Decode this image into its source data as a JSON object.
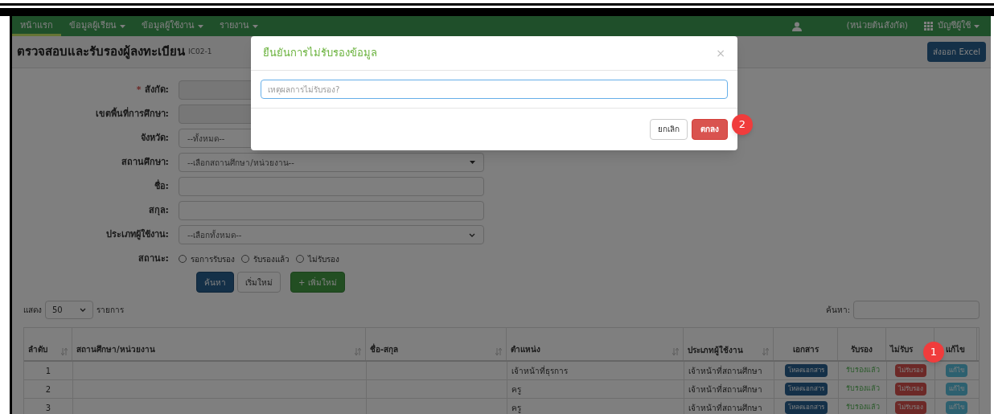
{
  "navbar": {
    "items": [
      {
        "label": "หน้าแรก",
        "selected": true,
        "dropdown": false
      },
      {
        "label": "ข้อมูลผู้เรียน",
        "selected": false,
        "dropdown": true
      },
      {
        "label": "ข้อมูลผู้ใช้งาน",
        "selected": false,
        "dropdown": true
      },
      {
        "label": "รายงาน",
        "selected": false,
        "dropdown": true
      }
    ],
    "unit": "(หน่วยต้นสังกัด)",
    "account": "บัญชีผู้ใช้"
  },
  "page": {
    "title": "ตรวจสอบและรับรองผู้ลงทะเบียน",
    "code": "IC02-1",
    "export_button": "ส่งออก Excel"
  },
  "form": {
    "fields": [
      {
        "label": "สังกัด:",
        "required_mark": "*",
        "kind": "locked"
      },
      {
        "label": "เขตพื้นที่การศึกษา:",
        "kind": "locked"
      },
      {
        "label": "จังหวัด:",
        "kind": "hidden-select",
        "value": "--ทั้งหมด--"
      },
      {
        "label": "สถานศึกษา:",
        "kind": "combo",
        "value": "--เลือกสถานศึกษา/หน่วยงาน--"
      },
      {
        "label": "ชื่อ:",
        "kind": "text"
      },
      {
        "label": "สกุล:",
        "kind": "text"
      },
      {
        "label": "ประเภทผู้ใช้งาน:",
        "kind": "select",
        "value": "--เลือกทั้งหมด--"
      }
    ],
    "status_label": "สถานะ:",
    "status_options": [
      {
        "label": "รอการรับรอง",
        "selected": false
      },
      {
        "label": "รับรองแล้ว",
        "selected": false
      },
      {
        "label": "ไม่รับรอง",
        "selected": false
      }
    ],
    "buttons": [
      {
        "label": "ค้นหา",
        "kind": "primary"
      },
      {
        "label": "เริ่มใหม่",
        "kind": "default"
      },
      {
        "label": "+ เพิ่มใหม่",
        "kind": "success"
      }
    ]
  },
  "table_controls": {
    "show_label": "แสดง",
    "page_size": "50",
    "entries_label": "รายการ",
    "search_label": "ค้นหา:"
  },
  "table": {
    "columns": [
      "ลำดับ",
      "สถานศึกษา/หน่วยงาน",
      "ชื่อ-สกุล",
      "ตำแหน่ง",
      "ประเภทผู้ใช้งาน",
      "เอกสาร",
      "รับรอง",
      "ไม่รับร",
      "แก้ไข"
    ],
    "rows": [
      {
        "index": "1",
        "position": "เจ้าหน้าที่ธุรการ",
        "user_type": "เจ้าหน้าที่สถานศึกษา",
        "document": "โหลดเอกสาร",
        "approved": "รับรองแล้ว",
        "reject": "ไม่รับรอง",
        "edit": "แก้ไข"
      },
      {
        "index": "2",
        "position": "ครู",
        "user_type": "เจ้าหน้าที่สถานศึกษา",
        "document": "โหลดเอกสาร",
        "approved": "รับรองแล้ว",
        "reject": "ไม่รับรอง",
        "edit": "แก้ไข"
      },
      {
        "index": "3",
        "position": "ครู",
        "user_type": "เจ้าหน้าที่สถานศึกษา",
        "document": "โหลดเอกสาร",
        "approved": "รับรองแล้ว",
        "reject": "ไม่รับรอง",
        "edit": "แก้ไข"
      }
    ]
  },
  "modal": {
    "title": "ยืนยันการไม่รับรองข้อมูล",
    "close": "×",
    "placeholder": "เหตุผลการไม่รับรอง?",
    "cancel": "ยกเลิก",
    "confirm": "ตกลง"
  },
  "markers": [
    {
      "label": "1"
    },
    {
      "label": "2"
    }
  ]
}
